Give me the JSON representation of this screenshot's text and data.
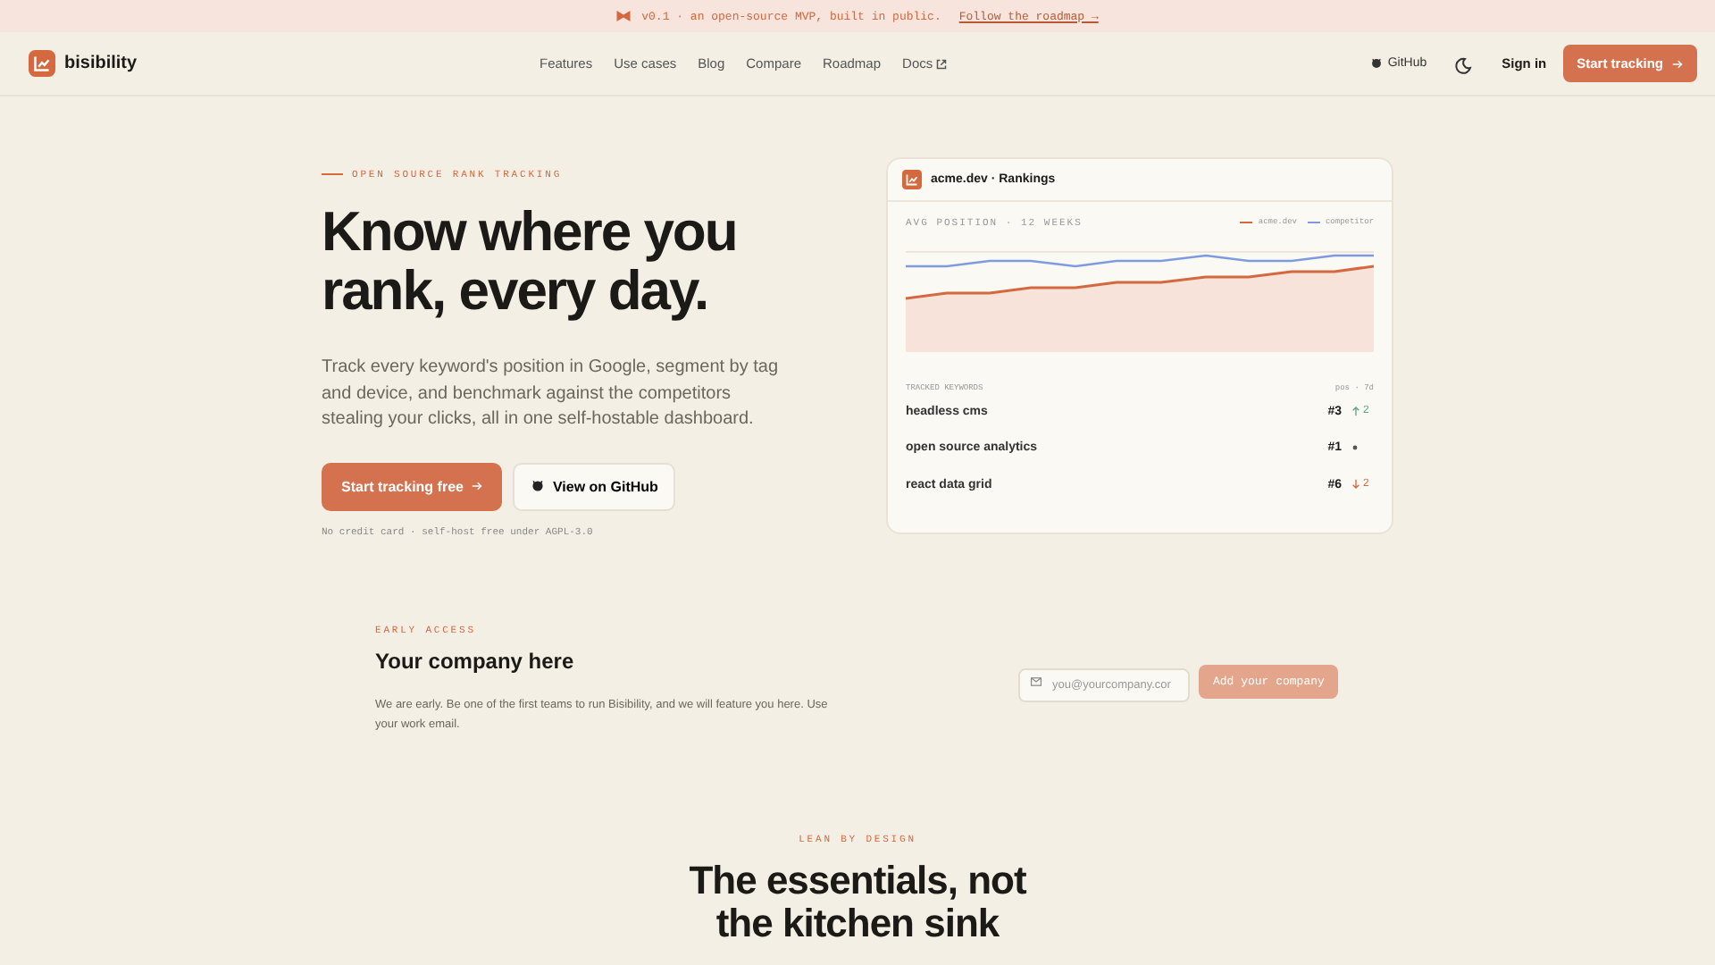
{
  "banner": {
    "text": "v0.1 · an open-source MVP, built in public.",
    "link": "Follow the roadmap →"
  },
  "header": {
    "brand": "bisibility",
    "nav": [
      "Features",
      "Use cases",
      "Blog",
      "Compare",
      "Roadmap",
      "Docs"
    ],
    "github": "GitHub",
    "sign_in": "Sign in",
    "cta": "Start tracking"
  },
  "hero": {
    "eyebrow": "OPEN SOURCE RANK TRACKING",
    "title": "Know where you rank, every day.",
    "body": "Track every keyword's position in Google, segment by tag and device, and benchmark against the competitors stealing your clicks, all in one self-hostable dashboard.",
    "primary": "Start tracking free",
    "secondary": "View on GitHub",
    "note": "No credit card · self-host free under AGPL-3.0"
  },
  "card": {
    "title": "acme.dev · Rankings",
    "chart_label": "AVG POSITION · 12 WEEKS",
    "legend": [
      {
        "name": "acme.dev",
        "color": "#d4683f"
      },
      {
        "name": "competitor",
        "color": "#7f9be0"
      }
    ],
    "keywords_label": "TRACKED KEYWORDS",
    "keywords_meta": "pos · 7d",
    "keywords": [
      {
        "name": "headless cms",
        "position": "#3",
        "kind": "up",
        "change": "2"
      },
      {
        "name": "open source analytics",
        "position": "#1",
        "kind": "flat"
      },
      {
        "name": "react data grid",
        "position": "#6",
        "kind": "down",
        "change": "2"
      }
    ]
  },
  "early": {
    "eyebrow": "EARLY ACCESS",
    "title": "Your company here",
    "body": "We are early. Be one of the first teams to run Bisibility, and we will feature you here. Use your work email.",
    "placeholder": "you@yourcompany.cor",
    "button": "Add your company"
  },
  "lean": {
    "eyebrow": "LEAN BY DESIGN",
    "title": "The essentials, not the kitchen sink"
  }
}
